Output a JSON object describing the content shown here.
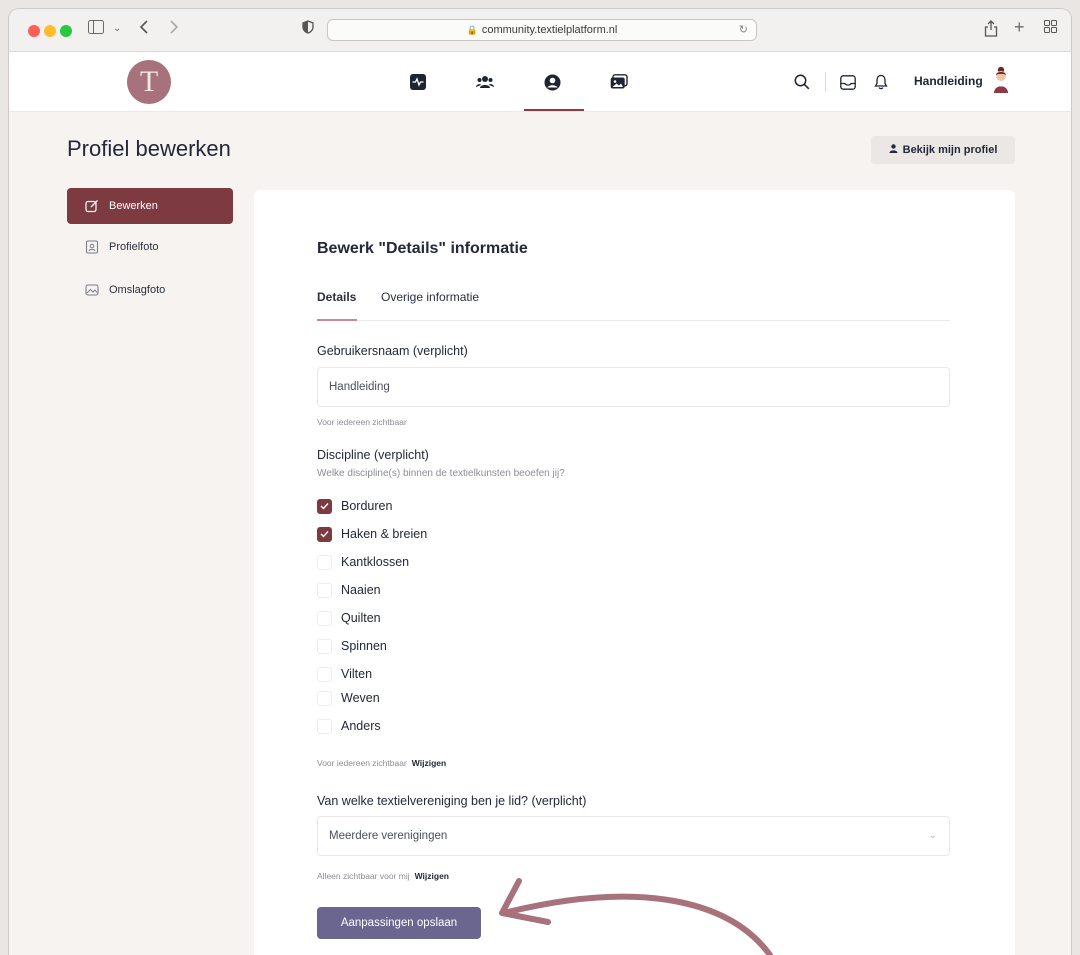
{
  "browser": {
    "url": "community.textielplatform.nl"
  },
  "header": {
    "logo_letter": "T",
    "user_name": "Handleiding"
  },
  "page": {
    "title": "Profiel bewerken",
    "view_profile_label": "Bekijk mijn profiel"
  },
  "sidebar": {
    "items": [
      {
        "label": "Bewerken",
        "active": true
      },
      {
        "label": "Profielfoto",
        "active": false
      },
      {
        "label": "Omslagfoto",
        "active": false
      }
    ]
  },
  "form": {
    "title": "Bewerk \"Details\" informatie",
    "tabs": [
      "Details",
      "Overige informatie"
    ],
    "username": {
      "label": "Gebruikersnaam (verplicht)",
      "value": "Handleiding",
      "visibility": "Voor iedereen zichtbaar"
    },
    "discipline": {
      "label": "Discipline (verplicht)",
      "description": "Welke discipline(s) binnen de textielkunsten beoefen jij?",
      "options": [
        {
          "label": "Borduren",
          "checked": true
        },
        {
          "label": "Haken & breien",
          "checked": true
        },
        {
          "label": "Kantklossen",
          "checked": false
        },
        {
          "label": "Naaien",
          "checked": false
        },
        {
          "label": "Quilten",
          "checked": false
        },
        {
          "label": "Spinnen",
          "checked": false
        },
        {
          "label": "Vilten",
          "checked": false
        },
        {
          "label": "Weven",
          "checked": false
        },
        {
          "label": "Anders",
          "checked": false
        }
      ],
      "visibility": "Voor iedereen zichtbaar",
      "change_label": "Wijzigen"
    },
    "association": {
      "label": "Van welke textielvereniging ben je lid? (verplicht)",
      "value": "Meerdere verenigingen",
      "visibility": "Alleen zichtbaar voor mij",
      "change_label": "Wijzigen"
    },
    "save_label": "Aanpassingen opslaan"
  },
  "colors": {
    "accent": "#7d3a40",
    "save_button": "#6a6690",
    "annotation_arrow": "#a8727c"
  }
}
